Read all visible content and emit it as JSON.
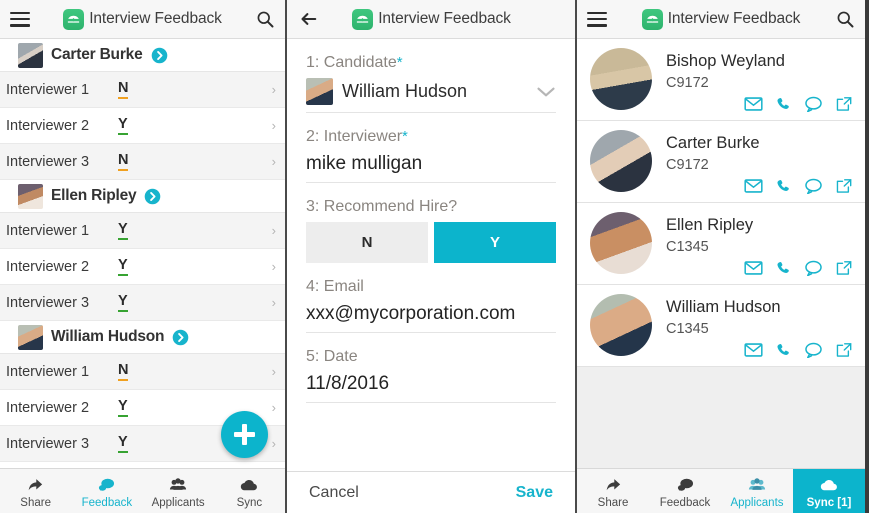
{
  "colors": {
    "accent_teal": "#0cb4cc",
    "accent_teal_text": "#17b4cc",
    "logo_green": "#33bd74",
    "vote_yes": "#37a332",
    "vote_no": "#f0a020",
    "label_gray": "#8a8580"
  },
  "app": {
    "title": "Interview Feedback",
    "logo_icon": "app-logo-icon",
    "menu_icon": "hamburger-menu-icon",
    "search_icon": "search-icon",
    "back_icon": "back-arrow-icon"
  },
  "left_panel": {
    "groups": [
      {
        "name": "Carter Burke",
        "avatar_icon": "avatar-carter-burke",
        "go_icon": "go-arrow-icon",
        "rows": [
          {
            "label": "Interviewer 1",
            "value": "N",
            "vote": "n"
          },
          {
            "label": "Interviewer 2",
            "value": "Y",
            "vote": "y"
          },
          {
            "label": "Interviewer 3",
            "value": "N",
            "vote": "n"
          }
        ]
      },
      {
        "name": "Ellen Ripley",
        "avatar_icon": "avatar-ellen-ripley",
        "go_icon": "go-arrow-icon",
        "rows": [
          {
            "label": "Interviewer 1",
            "value": "Y",
            "vote": "y"
          },
          {
            "label": "Interviewer 2",
            "value": "Y",
            "vote": "y"
          },
          {
            "label": "Interviewer 3",
            "value": "Y",
            "vote": "y"
          }
        ]
      },
      {
        "name": "William Hudson",
        "avatar_icon": "avatar-william-hudson",
        "go_icon": "go-arrow-icon",
        "rows": [
          {
            "label": "Interviewer 1",
            "value": "N",
            "vote": "n"
          },
          {
            "label": "Interviewer 2",
            "value": "Y",
            "vote": "y"
          },
          {
            "label": "Interviewer 3",
            "value": "Y",
            "vote": "y"
          }
        ]
      }
    ],
    "fab": {
      "icon": "plus-icon",
      "label": "Add"
    },
    "tabs": [
      {
        "label": "Share",
        "icon": "share-icon",
        "state": "normal"
      },
      {
        "label": "Feedback",
        "icon": "feedback-chat-icon",
        "state": "active"
      },
      {
        "label": "Applicants",
        "icon": "applicants-people-icon",
        "state": "normal"
      },
      {
        "label": "Sync",
        "icon": "sync-cloud-icon",
        "state": "normal"
      }
    ]
  },
  "middle_panel": {
    "fields": {
      "candidate": {
        "label": "1: Candidate",
        "required_marker": "*",
        "value": "William Hudson",
        "avatar_icon": "avatar-william-hudson",
        "chevron_icon": "chevron-down-icon"
      },
      "interviewer": {
        "label": "2: Interviewer",
        "required_marker": "*",
        "value": "mike mulligan",
        "placeholder": "Interviewer name"
      },
      "recommend": {
        "label": "3: Recommend Hire?",
        "option_no": "N",
        "option_yes": "Y",
        "selected": "Y"
      },
      "email": {
        "label": "4: Email",
        "value": "xxx@mycorporation.com",
        "placeholder": "Email address"
      },
      "date": {
        "label": "5: Date",
        "value": "11/8/2016",
        "placeholder": "Date"
      }
    },
    "footer": {
      "cancel": "Cancel",
      "save": "Save"
    }
  },
  "right_panel": {
    "contacts": [
      {
        "name": "Bishop Weyland",
        "id": "C9172",
        "avatar_icon": "avatar-bishop-weyland"
      },
      {
        "name": "Carter Burke",
        "id": "C9172",
        "avatar_icon": "avatar-carter-burke"
      },
      {
        "name": "Ellen Ripley",
        "id": "C1345",
        "avatar_icon": "avatar-ellen-ripley"
      },
      {
        "name": "William Hudson",
        "id": "C1345",
        "avatar_icon": "avatar-william-hudson"
      }
    ],
    "contact_actions": [
      "email-icon",
      "phone-icon",
      "message-icon",
      "open-external-icon"
    ],
    "tabs": [
      {
        "label": "Share",
        "icon": "share-icon",
        "state": "normal"
      },
      {
        "label": "Feedback",
        "icon": "feedback-chat-icon",
        "state": "normal"
      },
      {
        "label": "Applicants",
        "icon": "applicants-people-icon",
        "state": "active"
      },
      {
        "label": "Sync [1]",
        "icon": "sync-cloud-icon",
        "state": "filled"
      }
    ]
  }
}
